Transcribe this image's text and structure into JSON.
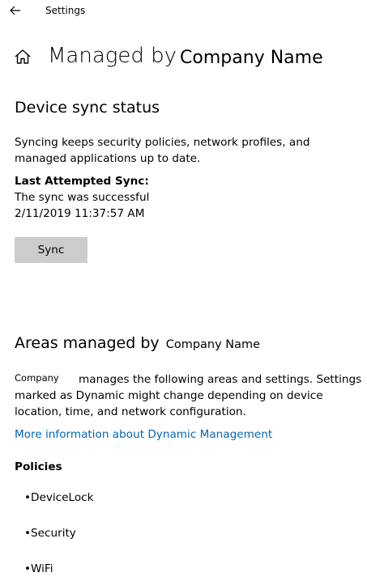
{
  "window": {
    "app_title": "Settings"
  },
  "header": {
    "title": "Managed by",
    "org_name": "Company Name"
  },
  "sync_section": {
    "heading": "Device sync status",
    "description": "Syncing keeps security policies, network profiles, and managed applications up to date.",
    "last_sync_label": "Last Attempted Sync:",
    "last_sync_status": "The sync was successful",
    "last_sync_time": "2/11/2019 11:37:57 AM",
    "sync_button_label": "Sync"
  },
  "areas_section": {
    "heading": "Areas managed by",
    "org_name": "Company Name",
    "org_short": "Company",
    "description": "manages the following areas and settings. Settings marked as Dynamic might change depending on device location, time, and network configuration.",
    "more_info_link": "More information about Dynamic Management",
    "policies_label": "Policies",
    "policies": [
      "•DeviceLock",
      "•Security",
      "•WiFi"
    ]
  },
  "colors": {
    "link": "#0067b8",
    "button_bg": "#cccccc",
    "background": "#ffffff"
  },
  "icons": {
    "back": "back-arrow-icon",
    "home": "home-icon"
  }
}
